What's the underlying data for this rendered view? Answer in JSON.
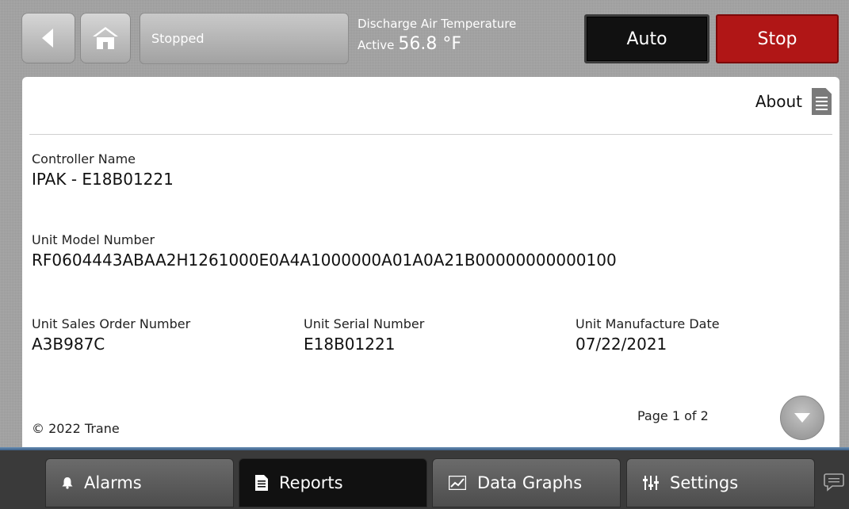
{
  "header": {
    "status": "Stopped",
    "temp_label": "Discharge Air Temperature",
    "temp_active_label": "Active",
    "temp_value": "56.8 °F",
    "auto_label": "Auto",
    "stop_label": "Stop"
  },
  "page": {
    "title": "About",
    "fields": {
      "controller_name": {
        "label": "Controller Name",
        "value": "IPAK - E18B01221"
      },
      "unit_model_number": {
        "label": "Unit Model Number",
        "value": "RF0604443ABAA2H1261000E0A4A1000000A01A0A21B00000000000100"
      },
      "sales_order": {
        "label": "Unit Sales Order Number",
        "value": "A3B987C"
      },
      "serial_number": {
        "label": "Unit Serial Number",
        "value": "E18B01221"
      },
      "manufacture_date": {
        "label": "Unit Manufacture Date",
        "value": "07/22/2021"
      }
    },
    "copyright": "© 2022 Trane",
    "page_info": "Page 1 of 2"
  },
  "nav": {
    "alarms": "Alarms",
    "reports": "Reports",
    "data_graphs": "Data Graphs",
    "settings": "Settings"
  },
  "icons": [
    "back-arrow-icon",
    "home-icon",
    "document-icon",
    "chevron-down-icon",
    "bell-icon",
    "report-icon",
    "graph-icon",
    "settings-sliders-icon",
    "chat-icon"
  ],
  "colors": {
    "stop": "#b01616",
    "active_tab": "#111111",
    "accent_bar": "#4f7299"
  }
}
